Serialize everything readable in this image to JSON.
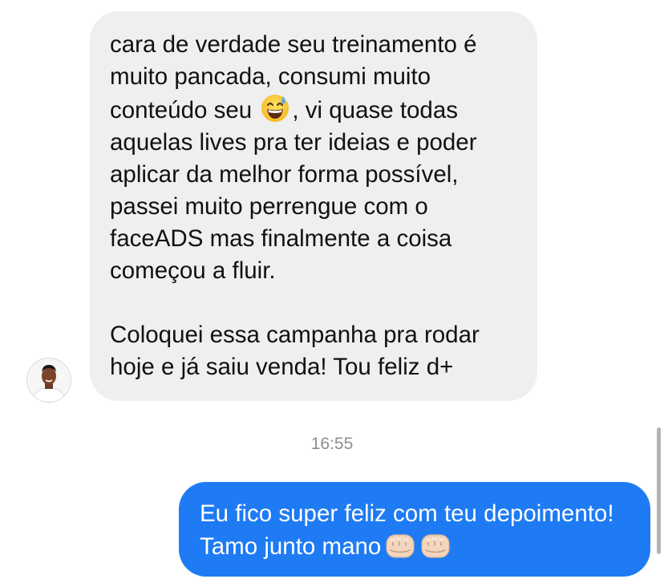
{
  "conversation": {
    "incoming": {
      "paragraph_1_before_emoji": "cara de verdade seu treinamento é muito pancada, consumi muito conteúdo seu",
      "emoji": "grinning-face-with-sweat",
      "paragraph_1_after_emoji": ", vi quase todas aquelas lives pra ter ideias e poder aplicar da melhor forma possível, passei muito perrengue com o faceADS mas finalmente a coisa começou a fluir.",
      "paragraph_2": "Coloquei essa campanha pra rodar hoje e já saiu venda! Tou feliz d+",
      "bubble_color": "#efefef"
    },
    "timestamp": "16:55",
    "outgoing": {
      "text": "Eu fico super feliz com teu depoimento! Tamo junto mano",
      "emojis": [
        "oncoming-fist-light-skin",
        "oncoming-fist-light-skin"
      ],
      "bubble_color": "#1e7bf4"
    }
  },
  "avatar": {
    "icon": "user-avatar"
  }
}
